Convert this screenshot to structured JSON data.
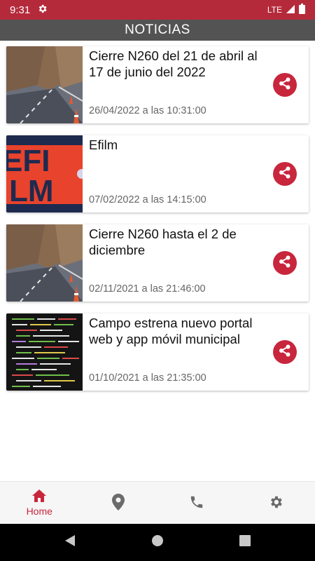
{
  "status_bar": {
    "time": "9:31",
    "network": "LTE"
  },
  "appbar": {
    "title": "NOTICIAS"
  },
  "news": [
    {
      "title": "Cierre N260 del 21 de abril al 17 de junio del 2022",
      "date": "26/04/2022 a las 10:31:00",
      "thumb": "road"
    },
    {
      "title": "Efilm",
      "date": "07/02/2022 a las 14:15:00",
      "thumb": "efilm-logo"
    },
    {
      "title": "Cierre N260 hasta el 2 de diciembre",
      "date": "02/11/2021 a las 21:46:00",
      "thumb": "road"
    },
    {
      "title": "Campo estrena nuevo portal web y app móvil municipal",
      "date": "01/10/2021 a las 21:35:00",
      "thumb": "code-screen"
    }
  ],
  "logo": {
    "efilm_top": "EFI",
    "efilm_bottom": "LM"
  },
  "bottom_nav": {
    "home_label": "Home"
  },
  "colors": {
    "accent": "#c8263d",
    "status_bar": "#b52a3b",
    "appbar": "#535353"
  }
}
